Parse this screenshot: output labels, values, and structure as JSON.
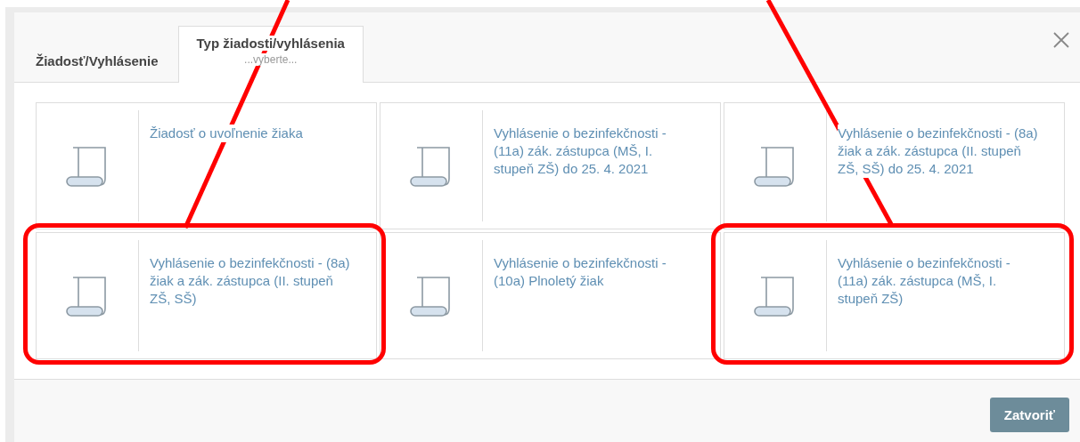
{
  "dialog": {
    "tabs": [
      {
        "label": "Žiadosť/Vyhlásenie",
        "selected": false
      },
      {
        "label": "Typ žiadosti/vyhlásenia",
        "sublabel": "...vyberte...",
        "selected": true
      }
    ],
    "items": [
      {
        "label": "Žiadosť o uvoľnenie žiaka",
        "highlighted": false
      },
      {
        "label": "Vyhlásenie o bezinfekčnosti - (11a) zák. zástupca (MŠ, I. stupeň ZŠ) do 25. 4. 2021",
        "highlighted": false
      },
      {
        "label": "Vyhlásenie o bezinfekčnosti - (8a) žiak a zák. zástupca (II. stupeň ZŠ, SŠ) do 25. 4. 2021",
        "highlighted": false
      },
      {
        "label": "Vyhlásenie o bezinfekčnosti - (8a) žiak a zák. zástupca (II. stupeň ZŠ, SŠ)",
        "highlighted": true
      },
      {
        "label": "Vyhlásenie o bezinfekčnosti - (10a) Plnoletý žiak",
        "highlighted": false
      },
      {
        "label": "Vyhlásenie o bezinfekčnosti - (11a) zák. zástupca (MŠ, I. stupeň ZŠ)",
        "highlighted": true
      }
    ],
    "close_button": "Zatvoriť"
  }
}
